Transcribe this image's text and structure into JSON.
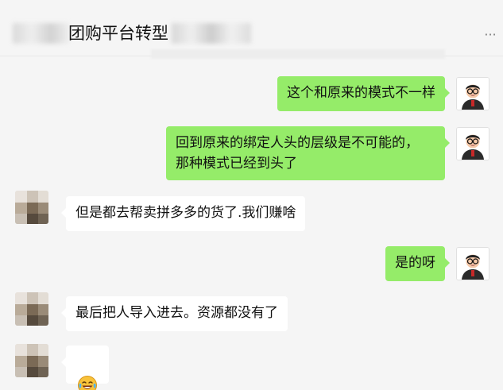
{
  "header": {
    "title_visible": "团购平台转型",
    "more_icon": "ellipsis-icon"
  },
  "messages": [
    {
      "from": "me",
      "text": "这个和原来的模式不一样"
    },
    {
      "from": "me",
      "text": "回到原来的绑定人头的层级是不可能的，\n那种模式已经到头了"
    },
    {
      "from": "other",
      "text": "但是都去帮卖拼多多的货了.我们赚啥"
    },
    {
      "from": "me",
      "text": "是的呀"
    },
    {
      "from": "other",
      "text": "最后把人导入进去。资源都没有了"
    },
    {
      "from": "other",
      "text": "",
      "emoji": "laughing-tears-emoji"
    }
  ],
  "colors": {
    "my_bubble": "#95ec69",
    "their_bubble": "#ffffff",
    "background": "#f5f5f5"
  }
}
